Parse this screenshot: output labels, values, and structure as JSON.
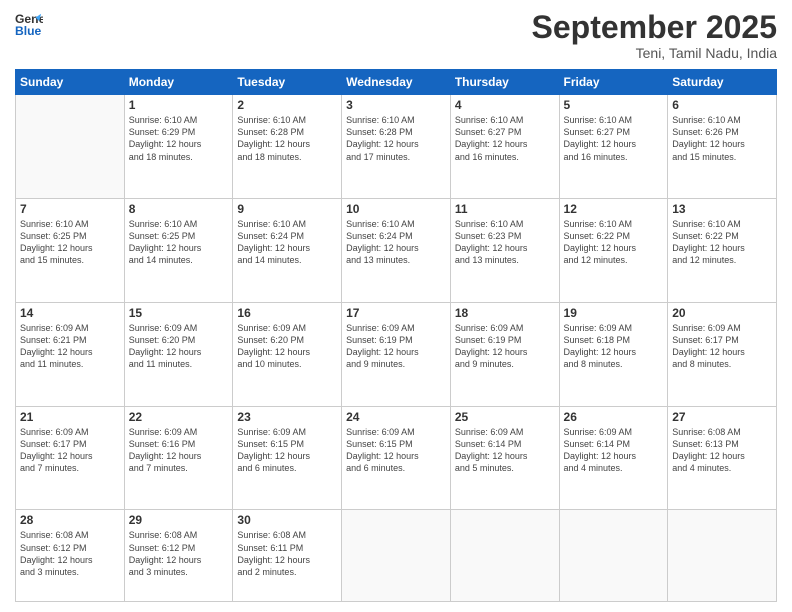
{
  "header": {
    "logo_line1": "General",
    "logo_line2": "Blue",
    "month": "September 2025",
    "location": "Teni, Tamil Nadu, India"
  },
  "weekdays": [
    "Sunday",
    "Monday",
    "Tuesday",
    "Wednesday",
    "Thursday",
    "Friday",
    "Saturday"
  ],
  "weeks": [
    [
      {
        "day": "",
        "info": ""
      },
      {
        "day": "1",
        "info": "Sunrise: 6:10 AM\nSunset: 6:29 PM\nDaylight: 12 hours\nand 18 minutes."
      },
      {
        "day": "2",
        "info": "Sunrise: 6:10 AM\nSunset: 6:28 PM\nDaylight: 12 hours\nand 18 minutes."
      },
      {
        "day": "3",
        "info": "Sunrise: 6:10 AM\nSunset: 6:28 PM\nDaylight: 12 hours\nand 17 minutes."
      },
      {
        "day": "4",
        "info": "Sunrise: 6:10 AM\nSunset: 6:27 PM\nDaylight: 12 hours\nand 16 minutes."
      },
      {
        "day": "5",
        "info": "Sunrise: 6:10 AM\nSunset: 6:27 PM\nDaylight: 12 hours\nand 16 minutes."
      },
      {
        "day": "6",
        "info": "Sunrise: 6:10 AM\nSunset: 6:26 PM\nDaylight: 12 hours\nand 15 minutes."
      }
    ],
    [
      {
        "day": "7",
        "info": "Sunrise: 6:10 AM\nSunset: 6:25 PM\nDaylight: 12 hours\nand 15 minutes."
      },
      {
        "day": "8",
        "info": "Sunrise: 6:10 AM\nSunset: 6:25 PM\nDaylight: 12 hours\nand 14 minutes."
      },
      {
        "day": "9",
        "info": "Sunrise: 6:10 AM\nSunset: 6:24 PM\nDaylight: 12 hours\nand 14 minutes."
      },
      {
        "day": "10",
        "info": "Sunrise: 6:10 AM\nSunset: 6:24 PM\nDaylight: 12 hours\nand 13 minutes."
      },
      {
        "day": "11",
        "info": "Sunrise: 6:10 AM\nSunset: 6:23 PM\nDaylight: 12 hours\nand 13 minutes."
      },
      {
        "day": "12",
        "info": "Sunrise: 6:10 AM\nSunset: 6:22 PM\nDaylight: 12 hours\nand 12 minutes."
      },
      {
        "day": "13",
        "info": "Sunrise: 6:10 AM\nSunset: 6:22 PM\nDaylight: 12 hours\nand 12 minutes."
      }
    ],
    [
      {
        "day": "14",
        "info": "Sunrise: 6:09 AM\nSunset: 6:21 PM\nDaylight: 12 hours\nand 11 minutes."
      },
      {
        "day": "15",
        "info": "Sunrise: 6:09 AM\nSunset: 6:20 PM\nDaylight: 12 hours\nand 11 minutes."
      },
      {
        "day": "16",
        "info": "Sunrise: 6:09 AM\nSunset: 6:20 PM\nDaylight: 12 hours\nand 10 minutes."
      },
      {
        "day": "17",
        "info": "Sunrise: 6:09 AM\nSunset: 6:19 PM\nDaylight: 12 hours\nand 9 minutes."
      },
      {
        "day": "18",
        "info": "Sunrise: 6:09 AM\nSunset: 6:19 PM\nDaylight: 12 hours\nand 9 minutes."
      },
      {
        "day": "19",
        "info": "Sunrise: 6:09 AM\nSunset: 6:18 PM\nDaylight: 12 hours\nand 8 minutes."
      },
      {
        "day": "20",
        "info": "Sunrise: 6:09 AM\nSunset: 6:17 PM\nDaylight: 12 hours\nand 8 minutes."
      }
    ],
    [
      {
        "day": "21",
        "info": "Sunrise: 6:09 AM\nSunset: 6:17 PM\nDaylight: 12 hours\nand 7 minutes."
      },
      {
        "day": "22",
        "info": "Sunrise: 6:09 AM\nSunset: 6:16 PM\nDaylight: 12 hours\nand 7 minutes."
      },
      {
        "day": "23",
        "info": "Sunrise: 6:09 AM\nSunset: 6:15 PM\nDaylight: 12 hours\nand 6 minutes."
      },
      {
        "day": "24",
        "info": "Sunrise: 6:09 AM\nSunset: 6:15 PM\nDaylight: 12 hours\nand 6 minutes."
      },
      {
        "day": "25",
        "info": "Sunrise: 6:09 AM\nSunset: 6:14 PM\nDaylight: 12 hours\nand 5 minutes."
      },
      {
        "day": "26",
        "info": "Sunrise: 6:09 AM\nSunset: 6:14 PM\nDaylight: 12 hours\nand 4 minutes."
      },
      {
        "day": "27",
        "info": "Sunrise: 6:08 AM\nSunset: 6:13 PM\nDaylight: 12 hours\nand 4 minutes."
      }
    ],
    [
      {
        "day": "28",
        "info": "Sunrise: 6:08 AM\nSunset: 6:12 PM\nDaylight: 12 hours\nand 3 minutes."
      },
      {
        "day": "29",
        "info": "Sunrise: 6:08 AM\nSunset: 6:12 PM\nDaylight: 12 hours\nand 3 minutes."
      },
      {
        "day": "30",
        "info": "Sunrise: 6:08 AM\nSunset: 6:11 PM\nDaylight: 12 hours\nand 2 minutes."
      },
      {
        "day": "",
        "info": ""
      },
      {
        "day": "",
        "info": ""
      },
      {
        "day": "",
        "info": ""
      },
      {
        "day": "",
        "info": ""
      }
    ]
  ]
}
